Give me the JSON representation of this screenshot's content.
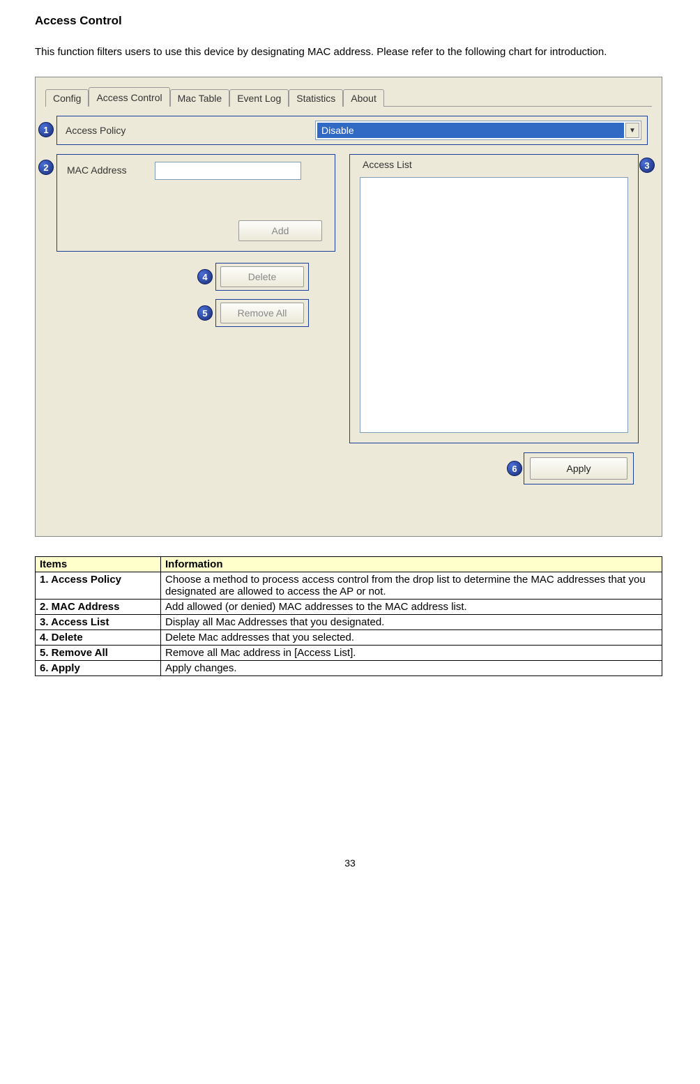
{
  "heading": "Access Control",
  "intro": "This function filters users to use this device by designating MAC address. Please refer to the following chart for introduction.",
  "tabs": [
    "Config",
    "Access Control",
    "Mac Table",
    "Event Log",
    "Statistics",
    "About"
  ],
  "policy": {
    "label": "Access Policy",
    "value": "Disable"
  },
  "mac": {
    "label": "MAC Address",
    "value": ""
  },
  "buttons": {
    "add": "Add",
    "delete": "Delete",
    "remove_all": "Remove All",
    "apply": "Apply"
  },
  "access_list": {
    "label": "Access List"
  },
  "markers": {
    "m1": "1",
    "m2": "2",
    "m3": "3",
    "m4": "4",
    "m5": "5",
    "m6": "6"
  },
  "table": {
    "headers": [
      "Items",
      "Information"
    ],
    "rows": [
      {
        "item": "1. Access Policy",
        "info": "Choose a method to process access control from the drop list to determine the MAC addresses that you designated are allowed to access the AP or not."
      },
      {
        "item": "2. MAC Address",
        "info": "Add allowed (or denied) MAC addresses to the MAC address list."
      },
      {
        "item": "3. Access List",
        "info": "Display all Mac Addresses that you designated."
      },
      {
        "item": "4. Delete",
        "info": "Delete Mac addresses that you selected."
      },
      {
        "item": "5. Remove All",
        "info": "Remove all Mac address in [Access List]."
      },
      {
        "item": "6. Apply",
        "info": "Apply changes."
      }
    ]
  },
  "page_number": "33"
}
